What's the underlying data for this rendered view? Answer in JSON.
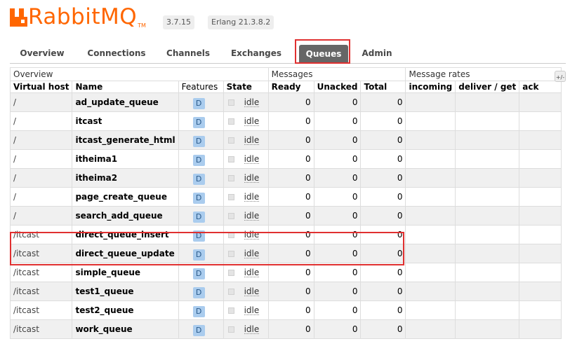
{
  "app": {
    "logo_text": "RabbitMQ",
    "logo_tm": "TM",
    "version": "3.7.15",
    "erlang": "Erlang 21.3.8.2",
    "brand_color": "#ff6600"
  },
  "nav": {
    "tabs": [
      {
        "label": "Overview"
      },
      {
        "label": "Connections"
      },
      {
        "label": "Channels"
      },
      {
        "label": "Exchanges"
      },
      {
        "label": "Queues"
      },
      {
        "label": "Admin"
      }
    ],
    "active": "Queues"
  },
  "table": {
    "groups": {
      "overview": "Overview",
      "messages": "Messages",
      "rates": "Message rates"
    },
    "columns": {
      "vhost": "Virtual host",
      "name": "Name",
      "features": "Features",
      "state": "State",
      "ready": "Ready",
      "unacked": "Unacked",
      "total": "Total",
      "incoming": "incoming",
      "deliver": "deliver / get",
      "ack": "ack"
    },
    "add_column_label": "+/-",
    "rows": [
      {
        "vhost": "/",
        "name": "ad_update_queue",
        "feature": "D",
        "state": "idle",
        "ready": "0",
        "unacked": "0",
        "total": "0"
      },
      {
        "vhost": "/",
        "name": "itcast",
        "feature": "D",
        "state": "idle",
        "ready": "0",
        "unacked": "0",
        "total": "0"
      },
      {
        "vhost": "/",
        "name": "itcast_generate_html",
        "feature": "D",
        "state": "idle",
        "ready": "0",
        "unacked": "0",
        "total": "0"
      },
      {
        "vhost": "/",
        "name": "itheima1",
        "feature": "D",
        "state": "idle",
        "ready": "0",
        "unacked": "0",
        "total": "0"
      },
      {
        "vhost": "/",
        "name": "itheima2",
        "feature": "D",
        "state": "idle",
        "ready": "0",
        "unacked": "0",
        "total": "0"
      },
      {
        "vhost": "/",
        "name": "page_create_queue",
        "feature": "D",
        "state": "idle",
        "ready": "0",
        "unacked": "0",
        "total": "0"
      },
      {
        "vhost": "/",
        "name": "search_add_queue",
        "feature": "D",
        "state": "idle",
        "ready": "0",
        "unacked": "0",
        "total": "0"
      },
      {
        "vhost": "/itcast",
        "name": "direct_queue_insert",
        "feature": "D",
        "state": "idle",
        "ready": "0",
        "unacked": "0",
        "total": "0"
      },
      {
        "vhost": "/itcast",
        "name": "direct_queue_update",
        "feature": "D",
        "state": "idle",
        "ready": "0",
        "unacked": "0",
        "total": "0"
      },
      {
        "vhost": "/itcast",
        "name": "simple_queue",
        "feature": "D",
        "state": "idle",
        "ready": "0",
        "unacked": "0",
        "total": "0"
      },
      {
        "vhost": "/itcast",
        "name": "test1_queue",
        "feature": "D",
        "state": "idle",
        "ready": "0",
        "unacked": "0",
        "total": "0"
      },
      {
        "vhost": "/itcast",
        "name": "test2_queue",
        "feature": "D",
        "state": "idle",
        "ready": "0",
        "unacked": "0",
        "total": "0"
      },
      {
        "vhost": "/itcast",
        "name": "work_queue",
        "feature": "D",
        "state": "idle",
        "ready": "0",
        "unacked": "0",
        "total": "0"
      }
    ]
  },
  "colors": {
    "highlight_box": "#e03030",
    "active_tab_bg": "#666666",
    "feature_badge_bg": "#aaccee",
    "row_alt_bg": "#f0f0f0"
  }
}
